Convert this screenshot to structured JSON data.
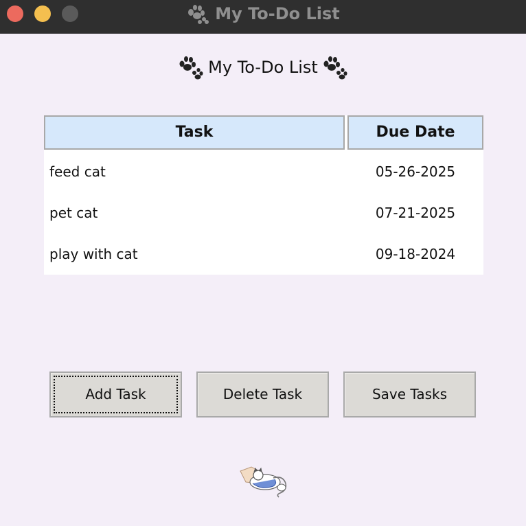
{
  "window": {
    "title": "My To-Do List"
  },
  "heading": "My To-Do List",
  "table": {
    "columns": [
      "Task",
      "Due Date"
    ],
    "rows": [
      {
        "task": "feed cat",
        "due": "05-26-2025"
      },
      {
        "task": "pet cat",
        "due": "07-21-2025"
      },
      {
        "task": "play with cat",
        "due": "09-18-2024"
      }
    ]
  },
  "buttons": {
    "add": "Add Task",
    "delete": "Delete Task",
    "save": "Save Tasks"
  },
  "icons": {
    "paw": "paw-prints-icon",
    "mascot": "sleeping-cat-icon"
  },
  "colors": {
    "background": "#f4eef8",
    "header_fill": "#d6e8fb",
    "button_fill": "#dcdad6",
    "close": "#ec6a5e",
    "minimize": "#f4bf4f"
  }
}
